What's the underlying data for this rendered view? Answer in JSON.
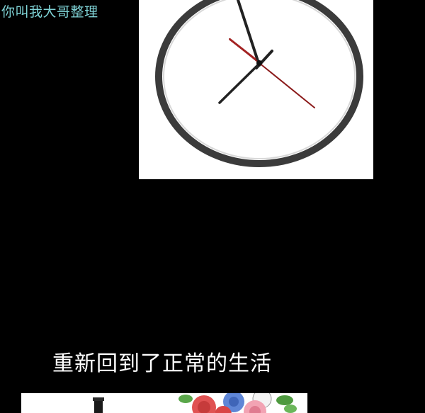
{
  "watermark": {
    "text": "你叫我大哥整理",
    "color": "#7fd3d6"
  },
  "caption": {
    "text": "重新回到了正常的生活",
    "color": "#ffffff"
  },
  "clock": {
    "hour_hand": "black",
    "minute_hand": "black",
    "second_hand": "#8b1a1a"
  },
  "colors": {
    "background": "#000000",
    "panel": "#ffffff",
    "clock_rim": "#3a3a3a"
  }
}
